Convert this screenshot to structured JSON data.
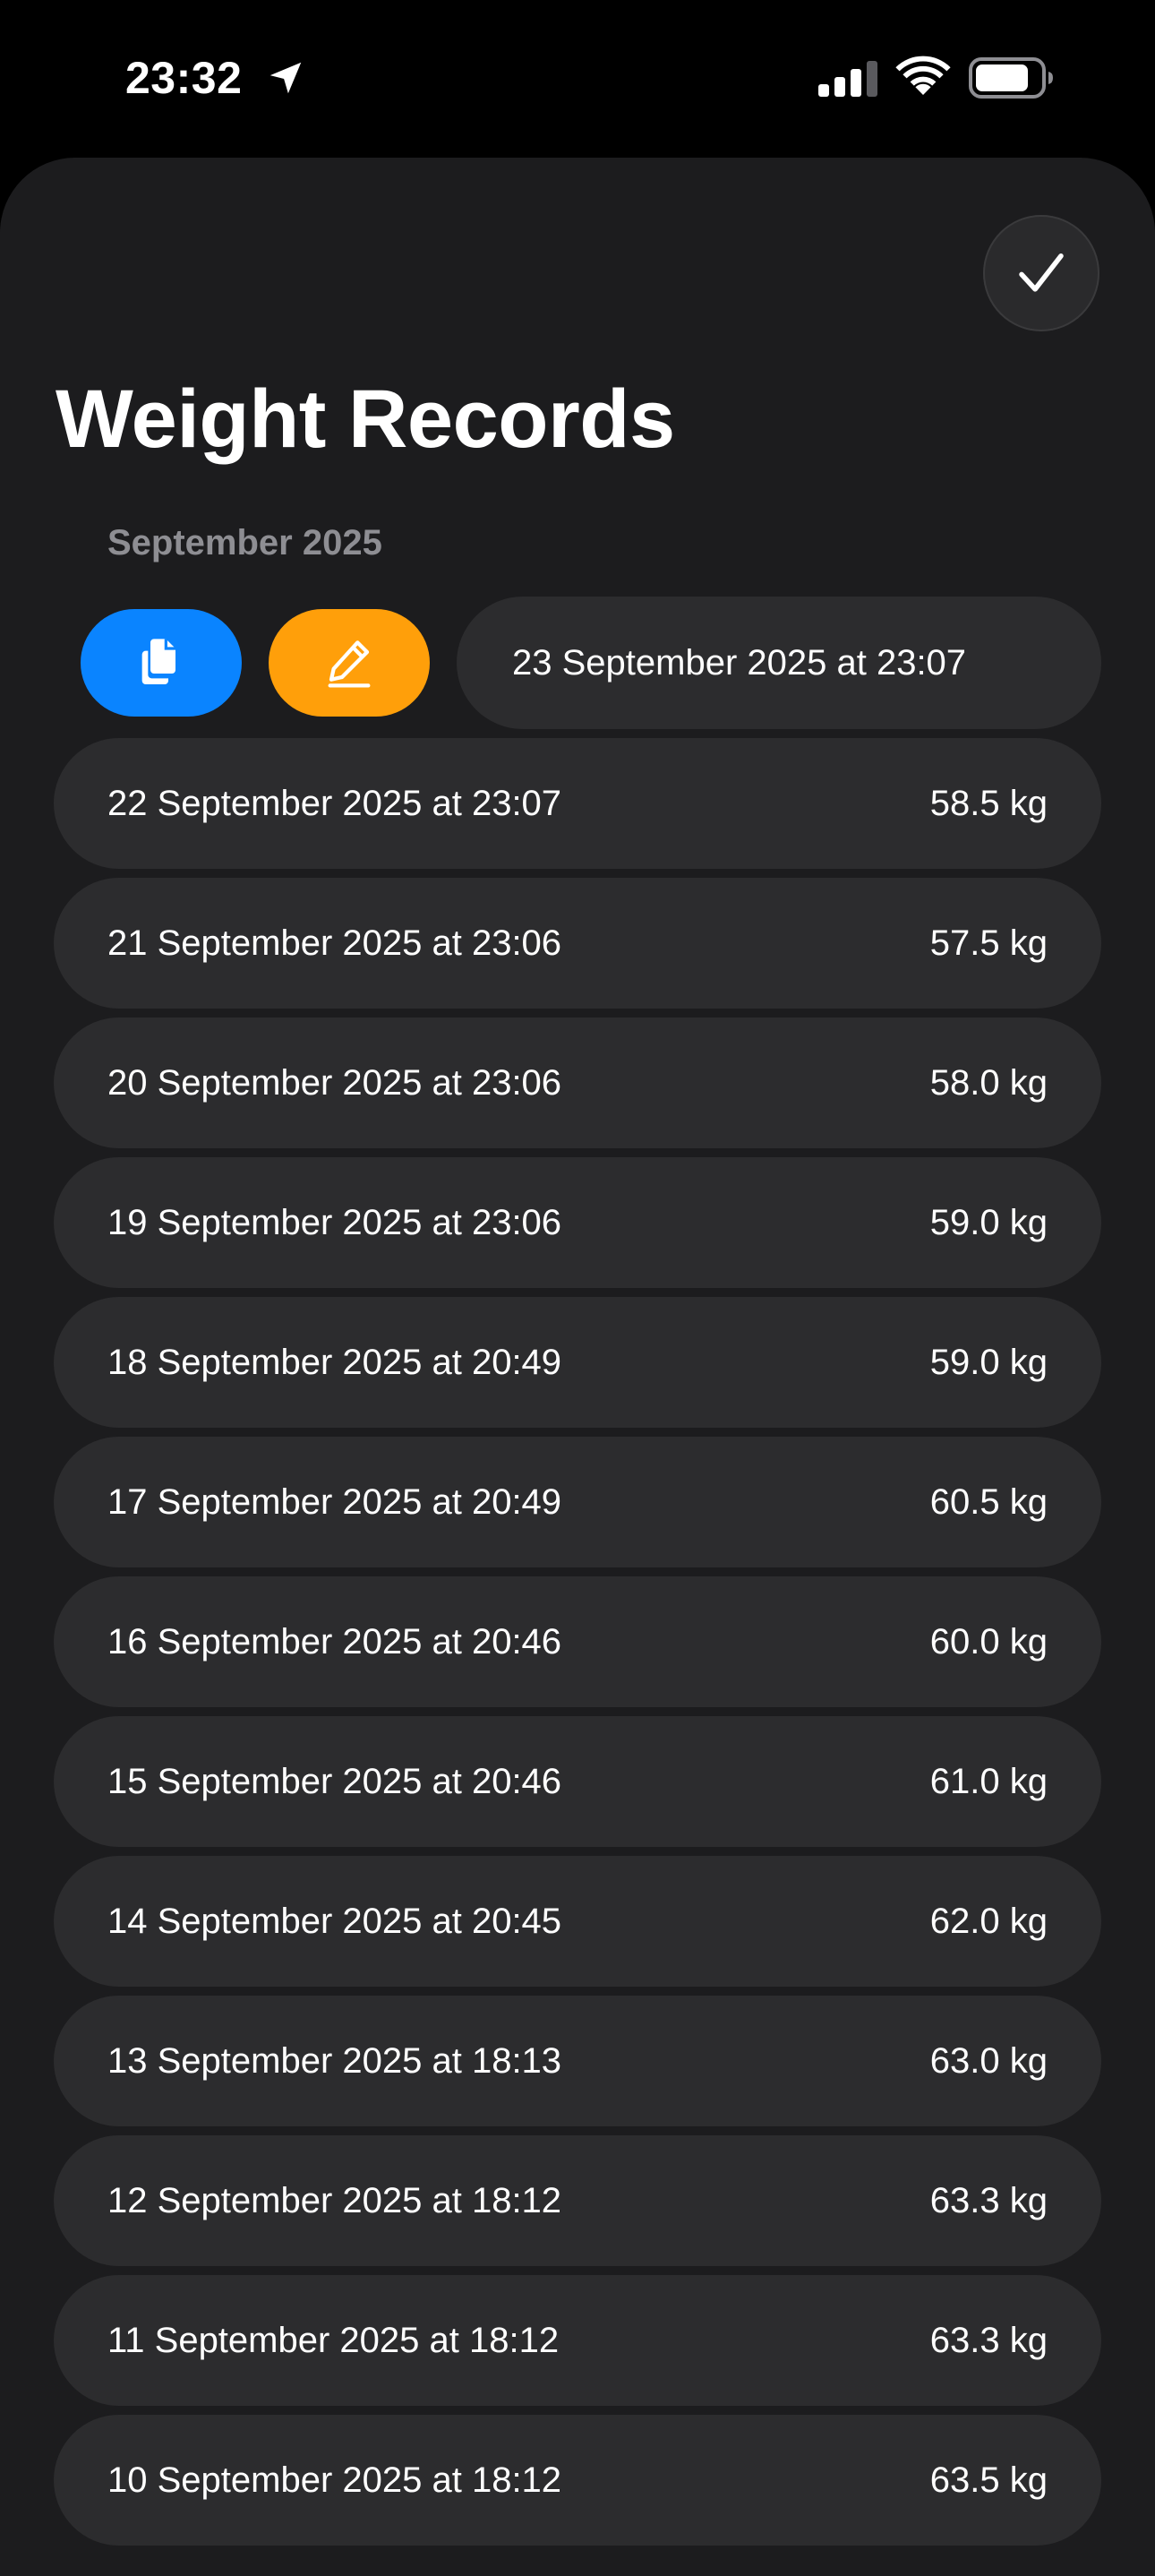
{
  "status_bar": {
    "time": "23:32",
    "icons": [
      "location-arrow-icon",
      "cellular-signal-icon",
      "wifi-icon",
      "battery-icon"
    ]
  },
  "header": {
    "done_icon": "checkmark-icon",
    "title": "Weight Records"
  },
  "section": {
    "title": "September 2025"
  },
  "swipe_actions": {
    "copy_icon": "copy-documents-icon",
    "copy_color": "#0a84ff",
    "edit_icon": "pencil-icon",
    "edit_color": "#ff9f0a",
    "record_date": "23 September 2025 at 23:07"
  },
  "records": [
    {
      "date": "22 September 2025 at 23:07",
      "weight": "58.5 kg"
    },
    {
      "date": "21 September 2025 at 23:06",
      "weight": "57.5 kg"
    },
    {
      "date": "20 September 2025 at 23:06",
      "weight": "58.0 kg"
    },
    {
      "date": "19 September 2025 at 23:06",
      "weight": "59.0 kg"
    },
    {
      "date": "18 September 2025 at 20:49",
      "weight": "59.0 kg"
    },
    {
      "date": "17 September 2025 at 20:49",
      "weight": "60.5 kg"
    },
    {
      "date": "16 September 2025 at 20:46",
      "weight": "60.0 kg"
    },
    {
      "date": "15 September 2025 at 20:46",
      "weight": "61.0 kg"
    },
    {
      "date": "14 September 2025 at 20:45",
      "weight": "62.0 kg"
    },
    {
      "date": "13 September 2025 at 18:13",
      "weight": "63.0 kg"
    },
    {
      "date": "12 September 2025 at 18:12",
      "weight": "63.3 kg"
    },
    {
      "date": "11 September 2025 at 18:12",
      "weight": "63.3 kg"
    },
    {
      "date": "10 September 2025 at 18:12",
      "weight": "63.5 kg"
    }
  ]
}
